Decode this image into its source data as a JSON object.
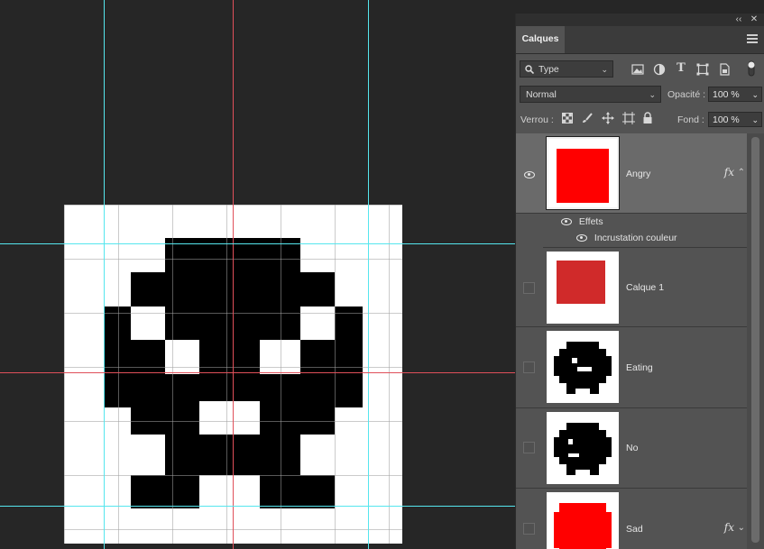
{
  "panel": {
    "tab_label": "Calques",
    "collapse_label": "‹‹",
    "close_label": "✕",
    "filter": {
      "kind_label": "Type"
    },
    "blend_mode": "Normal",
    "opacity_label": "Opacité :",
    "opacity_value": "100 %",
    "lock_label": "Verrou :",
    "fill_label": "Fond :",
    "fill_value": "100 %"
  },
  "layers": [
    {
      "name": "Angry",
      "visible": true,
      "selected": true,
      "has_fx": true,
      "thumbnail_color": "#ff0000",
      "effects_label": "Effets",
      "effects": [
        "Incrustation couleur"
      ]
    },
    {
      "name": "Calque 1",
      "visible": false,
      "thumbnail_color": "#d02a2a"
    },
    {
      "name": "Eating",
      "visible": false
    },
    {
      "name": "No",
      "visible": false
    },
    {
      "name": "Sad",
      "visible": false,
      "has_fx": true,
      "thumbnail_color": "#ff0000"
    }
  ],
  "colors": {
    "canvas_bg": "#262626",
    "panel_bg": "#535353",
    "selected_row": "#6a6a6a",
    "guide_cyan": "#55e6ee",
    "guide_red": "#e0505a",
    "sprite": "#000000"
  },
  "icons": {
    "fx": "fx",
    "chev_down": "⌄",
    "chev_up": "⌃"
  }
}
